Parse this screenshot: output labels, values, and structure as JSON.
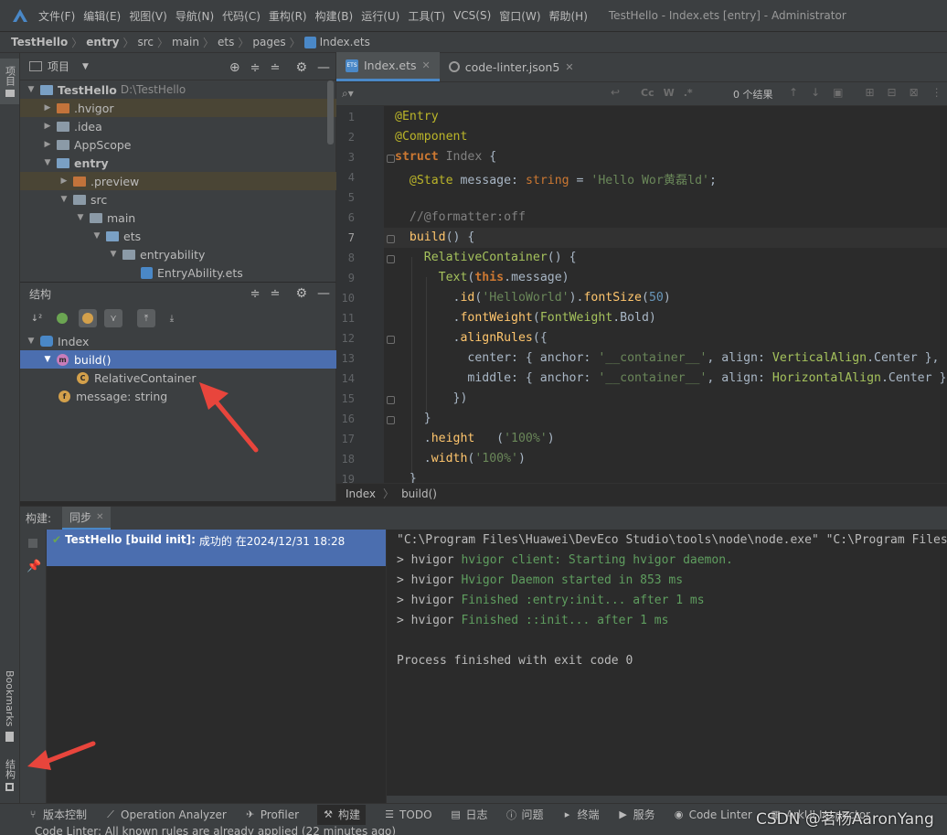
{
  "menubar": {
    "items": [
      "文件(F)",
      "编辑(E)",
      "视图(V)",
      "导航(N)",
      "代码(C)",
      "重构(R)",
      "构建(B)",
      "运行(U)",
      "工具(T)",
      "VCS(S)",
      "窗口(W)",
      "帮助(H)"
    ],
    "window_title": "TestHello - Index.ets [entry] - Administrator"
  },
  "breadcrumb": [
    "TestHello",
    "entry",
    "src",
    "main",
    "ets",
    "pages",
    "Index.ets"
  ],
  "left_strip": {
    "project_tab": "项目",
    "bookmarks_tab": "Bookmarks",
    "structure_tab": "结构"
  },
  "project": {
    "title": "项目",
    "tree": [
      {
        "label": "TestHello",
        "extra": "D:\\TestHello",
        "bold": true
      },
      {
        "label": ".hvigor"
      },
      {
        "label": ".idea"
      },
      {
        "label": "AppScope"
      },
      {
        "label": "entry",
        "bold": true
      },
      {
        "label": ".preview"
      },
      {
        "label": "src"
      },
      {
        "label": "main"
      },
      {
        "label": "ets"
      },
      {
        "label": "entryability"
      },
      {
        "label": "EntryAbility.ets"
      }
    ]
  },
  "structure": {
    "title": "结构",
    "tree": [
      {
        "label": "Index"
      },
      {
        "label": "build()"
      },
      {
        "label": "RelativeContainer"
      },
      {
        "label": "message: string"
      }
    ]
  },
  "editor": {
    "tabs": [
      {
        "label": "Index.ets",
        "active": true
      },
      {
        "label": "code-linter.json5",
        "active": false
      }
    ],
    "search": {
      "options": [
        "Cc",
        "W",
        ".*"
      ],
      "results": "0 个结果"
    },
    "line_numbers": [
      "1",
      "2",
      "3",
      "4",
      "5",
      "6",
      "7",
      "8",
      "9",
      "10",
      "11",
      "12",
      "13",
      "14",
      "15",
      "16",
      "17",
      "18",
      "19"
    ],
    "current_line": 7,
    "code": [
      "@Entry",
      "@Component",
      "struct Index {",
      "  @State message: string = 'Hello Wor黄磊ld';",
      "",
      "  //@formatter:off",
      "  build() {",
      "    RelativeContainer() {",
      "      Text(this.message)",
      "        .id('HelloWorld').fontSize(50)",
      "        .fontWeight(FontWeight.Bold)",
      "        .alignRules({",
      "          center: { anchor: '__container__', align: VerticalAlign.Center },",
      "          middle: { anchor: '__container__', align: HorizontalAlign.Center }",
      "        })",
      "    }",
      "    .height   ('100%')",
      "    .width('100%')",
      "  }"
    ],
    "crumb": [
      "Index",
      "build()"
    ]
  },
  "build": {
    "label": "构建:",
    "tab": "同步",
    "result_title": "TestHello [build init]:",
    "result_status": "成功的 在2024/12/31 18:28",
    "console": [
      "\"C:\\Program Files\\Huawei\\DevEco Studio\\tools\\node\\node.exe\" \"C:\\Program Files",
      "> hvigor hvigor client: Starting hvigor daemon.",
      "> hvigor Hvigor Daemon started in 853 ms",
      "> hvigor Finished :entry:init... after 1 ms",
      "> hvigor Finished ::init... after 1 ms",
      "",
      "Process finished with exit code 0"
    ]
  },
  "bottom_tools": [
    "版本控制",
    "Operation Analyzer",
    "Profiler",
    "构建",
    "TODO",
    "日志",
    "问题",
    "终端",
    "服务",
    "Code Linter",
    "ArkUI Inspector"
  ],
  "status": "Code Linter: All known rules are already applied (22 minutes ago)",
  "watermark": "CSDN @茗杨AaronYang",
  "colors": {
    "background": "#2b2b2b",
    "panel": "#3c3f41",
    "selection": "#4b6eaf",
    "accent": "#4a88c7",
    "arrow": "#e8453c"
  }
}
